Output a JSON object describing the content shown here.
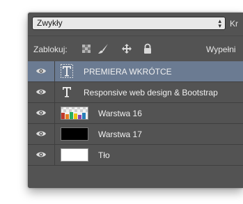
{
  "blend": {
    "mode": "Zwykły"
  },
  "opacity_label": "Kr",
  "lock": {
    "label": "Zablokuj:",
    "fill_label": "Wypełni"
  },
  "layers": [
    {
      "name": "PREMIERA WKRÓTCE",
      "type": "text",
      "selected": true
    },
    {
      "name": "Responsive web design & Bootstrap",
      "type": "text",
      "selected": false
    },
    {
      "name": "Warstwa 16",
      "type": "image",
      "selected": false
    },
    {
      "name": "Warstwa 17",
      "type": "image",
      "selected": false
    },
    {
      "name": "Tło",
      "type": "image",
      "selected": false
    }
  ],
  "colors": {
    "panel": "#535353",
    "selected_row": "#6b7b92",
    "text": "#f0f0f0"
  }
}
